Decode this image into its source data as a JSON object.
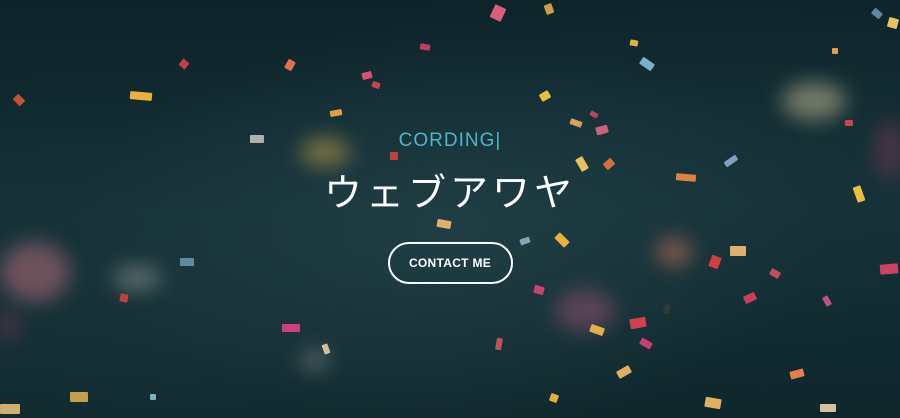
{
  "hero": {
    "subtitle": "CORDING",
    "cursor": "|",
    "title": "ウェブアワヤ",
    "contact_label": "CONTACT ME"
  },
  "colors": {
    "background": "#0f2a30",
    "accent": "#4fb4c9",
    "title": "#ffffff"
  }
}
